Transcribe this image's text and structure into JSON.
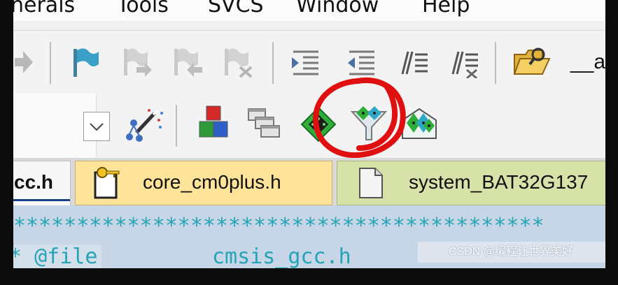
{
  "menu": {
    "items": [
      {
        "label": "nerals"
      },
      {
        "label": "Tools"
      },
      {
        "label": "SVCS"
      },
      {
        "label": "Window"
      },
      {
        "label": "Help"
      }
    ]
  },
  "toolbar": {
    "label_partial": "__a"
  },
  "tabs": [
    {
      "label": "cc.h",
      "active": true
    },
    {
      "label": "core_cm0plus.h",
      "active": false
    },
    {
      "label": "system_BAT32G137",
      "active": false
    }
  ],
  "editor": {
    "stars": "******************************************",
    "line_prefix": "* @file",
    "line_value": "cmsis_gcc.h"
  },
  "watermark": {
    "text": "CSDN @编程让世界美好"
  },
  "colors": {
    "annotation": "#e01010",
    "accent_teal": "#24a4b6",
    "tab_active": "#fde49a"
  }
}
